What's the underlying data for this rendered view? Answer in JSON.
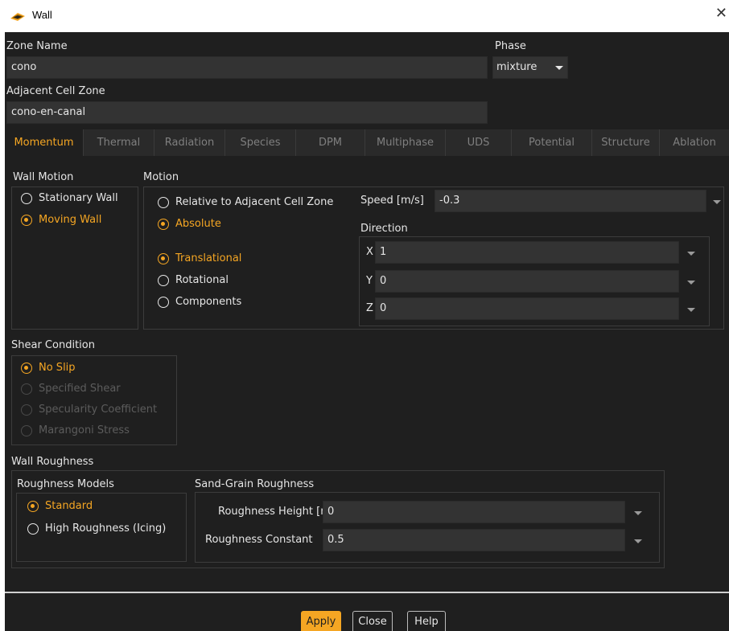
{
  "window": {
    "title": "Wall"
  },
  "zone_name": {
    "label": "Zone Name",
    "value": "cono"
  },
  "phase": {
    "label": "Phase",
    "value": "mixture"
  },
  "adjacent": {
    "label": "Adjacent Cell Zone",
    "value": "cono-en-canal"
  },
  "tabs": [
    {
      "label": "Momentum",
      "active": true
    },
    {
      "label": "Thermal"
    },
    {
      "label": "Radiation"
    },
    {
      "label": "Species"
    },
    {
      "label": "DPM"
    },
    {
      "label": "Multiphase"
    },
    {
      "label": "UDS"
    },
    {
      "label": "Potential"
    },
    {
      "label": "Structure"
    },
    {
      "label": "Ablation"
    }
  ],
  "wall_motion": {
    "title": "Wall Motion",
    "options": [
      {
        "label": "Stationary Wall",
        "selected": false
      },
      {
        "label": "Moving Wall",
        "selected": true
      }
    ]
  },
  "motion": {
    "title": "Motion",
    "reference": [
      {
        "label": "Relative to Adjacent Cell Zone",
        "selected": false
      },
      {
        "label": "Absolute",
        "selected": true
      }
    ],
    "type": [
      {
        "label": "Translational",
        "selected": true
      },
      {
        "label": "Rotational",
        "selected": false
      },
      {
        "label": "Components",
        "selected": false
      }
    ],
    "speed_label": "Speed [m/s]",
    "speed_value": "-0.3",
    "direction_label": "Direction",
    "direction": [
      {
        "axis": "X",
        "value": "1"
      },
      {
        "axis": "Y",
        "value": "0"
      },
      {
        "axis": "Z",
        "value": "0"
      }
    ]
  },
  "shear": {
    "title": "Shear Condition",
    "options": [
      {
        "label": "No Slip",
        "selected": true,
        "disabled": false
      },
      {
        "label": "Specified Shear",
        "selected": false,
        "disabled": true
      },
      {
        "label": "Specularity Coefficient",
        "selected": false,
        "disabled": true
      },
      {
        "label": "Marangoni Stress",
        "selected": false,
        "disabled": true
      }
    ]
  },
  "roughness": {
    "title": "Wall Roughness",
    "models_title": "Roughness Models",
    "models": [
      {
        "label": "Standard",
        "selected": true
      },
      {
        "label": "High Roughness (Icing)",
        "selected": false
      }
    ],
    "sand_title": "Sand-Grain Roughness",
    "height_label": "Roughness Height [m]",
    "height_value": "0",
    "constant_label": "Roughness Constant",
    "constant_value": "0.5"
  },
  "buttons": {
    "apply": "Apply",
    "close": "Close",
    "help": "Help"
  },
  "colors": {
    "accent": "#f5a623",
    "background": "#1f1f1f",
    "field": "#333333"
  }
}
